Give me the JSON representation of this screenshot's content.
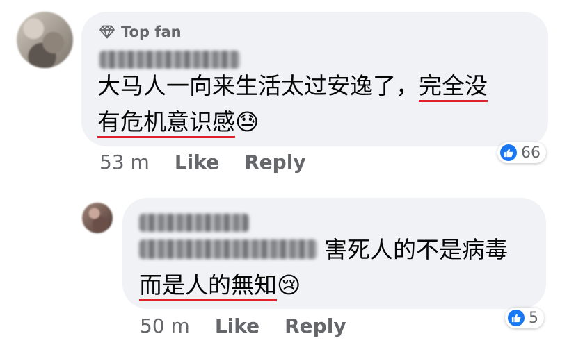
{
  "colors": {
    "bubble": "#f0f2f5",
    "like_blue": "#1877f2",
    "underline": "#e0202b",
    "meta": "#65676b"
  },
  "comment": {
    "badge": "Top fan",
    "line1_plain": "大马人一向来生活太过安逸了，",
    "line1_underlined": "完全没",
    "line2_underlined": "有危机意识感",
    "line2_emoji": "😓",
    "time": "53 m",
    "like": "Like",
    "reply": "Reply",
    "reaction_count": "66"
  },
  "reply_comment": {
    "line1_text": "害死人的不是病毒",
    "line2_underlined": "而是人的無知",
    "line2_emoji": "😢",
    "time": "50 m",
    "like": "Like",
    "reply": "Reply",
    "reaction_count": "5"
  },
  "icons": [
    "diamond-icon",
    "like-reaction-icon"
  ]
}
